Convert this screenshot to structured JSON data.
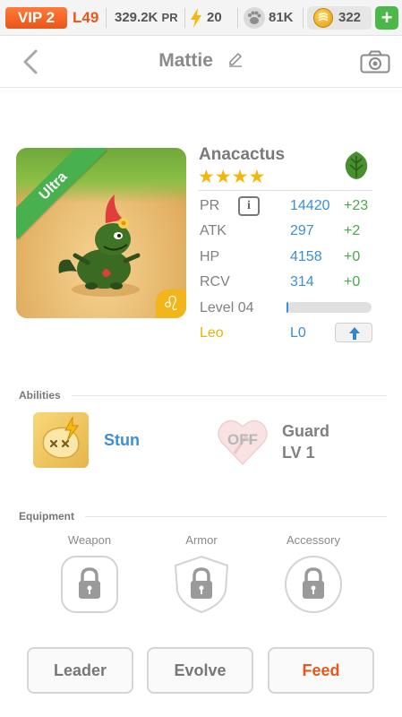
{
  "topbar": {
    "vip": "VIP 2",
    "level": "L49",
    "pr_value": "329.2K",
    "pr_unit": "PR",
    "energy": "20",
    "paws": "81K",
    "coins": "322",
    "plus": "+"
  },
  "header": {
    "title": "Mattie"
  },
  "pet": {
    "rarity": "Ultra",
    "name": "Anacactus",
    "stars": "★★★★",
    "zodiac_symbol": "♌",
    "stats": {
      "pr": {
        "label": "PR",
        "value": "14420",
        "inc": "+23"
      },
      "atk": {
        "label": "ATK",
        "value": "297",
        "inc": "+2"
      },
      "hp": {
        "label": "HP",
        "value": "4158",
        "inc": "+0"
      },
      "rcv": {
        "label": "RCV",
        "value": "314",
        "inc": "+0"
      }
    },
    "info_glyph": "i",
    "level_label": "Level 04",
    "xp_progress": 0.02,
    "zodiac_label": "Leo",
    "zodiac_level": "L0"
  },
  "abilities": {
    "section_title": "Abilities",
    "items": [
      {
        "name": "Stun"
      },
      {
        "name": "Guard",
        "level": "LV 1",
        "status": "OFF"
      }
    ]
  },
  "equipment": {
    "section_title": "Equipment",
    "slots": [
      "Weapon",
      "Armor",
      "Accessory"
    ]
  },
  "actions": {
    "leader": "Leader",
    "evolve": "Evolve",
    "feed": "Feed"
  },
  "colors": {
    "accent_orange": "#e9561a",
    "stat_blue": "#3a8fd6",
    "increase_green": "#4aa84a",
    "star_gold": "#f5b60c",
    "ultra_green": "#48b04d"
  }
}
